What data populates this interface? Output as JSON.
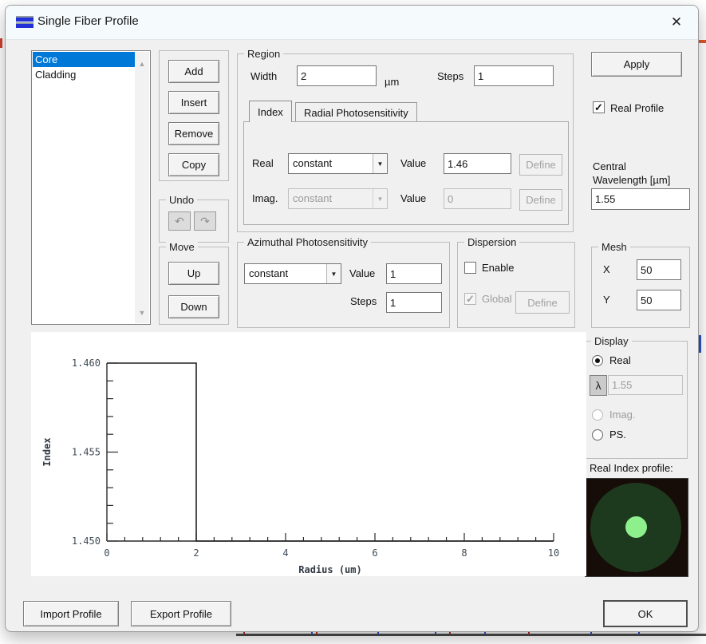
{
  "window": {
    "title": "Single Fiber Profile",
    "close_glyph": "✕"
  },
  "icons": {
    "up": "▲",
    "down": "▼",
    "undo": "↶",
    "redo": "↷",
    "check": "✓",
    "combo_arrow": "▼"
  },
  "colors": {
    "selection": "#0078d7",
    "title_bar": "#f5fafd",
    "dialog_bg": "#f0f0f0"
  },
  "layers": {
    "items": [
      {
        "label": "Core",
        "selected": true
      },
      {
        "label": "Cladding",
        "selected": false
      }
    ]
  },
  "actions": {
    "add": "Add",
    "insert": "Insert",
    "remove": "Remove",
    "copy": "Copy"
  },
  "undo_group": {
    "label": "Undo"
  },
  "move_group": {
    "label": "Move",
    "up": "Up",
    "down": "Down"
  },
  "region": {
    "label": "Region",
    "width_label": "Width",
    "width_value": "2",
    "width_unit": "µm",
    "steps_label": "Steps",
    "steps_value": "1",
    "tabs": {
      "index": "Index",
      "radial": "Radial Photosensitivity"
    },
    "index_tab": {
      "real_label": "Real",
      "real_mode": "constant",
      "real_value_label": "Value",
      "real_value": "1.46",
      "real_define": "Define",
      "imag_label": "Imag.",
      "imag_mode": "constant",
      "imag_value_label": "Value",
      "imag_value": "0",
      "imag_define": "Define"
    }
  },
  "azimuthal": {
    "label": "Azimuthal Photosensitivity",
    "mode": "constant",
    "value_label": "Value",
    "value": "1",
    "steps_label": "Steps",
    "steps_value": "1"
  },
  "dispersion": {
    "label": "Dispersion",
    "enable_label": "Enable",
    "global_label": "Global",
    "define_label": "Define"
  },
  "right_panel": {
    "apply_label": "Apply",
    "real_profile_label": "Real Profile",
    "central_wavelength_label_1": "Central",
    "central_wavelength_label_2": "Wavelength [µm]",
    "central_wavelength_value": "1.55"
  },
  "mesh": {
    "label": "Mesh",
    "x_label": "X",
    "x_value": "50",
    "y_label": "Y",
    "y_value": "50"
  },
  "display": {
    "label": "Display",
    "real_label": "Real",
    "lambda_glyph": "λ",
    "wavelength_value": "1.55",
    "imag_label": "Imag.",
    "ps_label": "PS."
  },
  "preview": {
    "label": "Real Index profile:",
    "colors": {
      "bg": "#170d08",
      "cladding": "#1e3a1e",
      "core": "#8df08d"
    }
  },
  "chart_data": {
    "type": "line",
    "title": "",
    "xlabel": "Radius (um)",
    "ylabel": "Index",
    "xlim": [
      0,
      10
    ],
    "ylim": [
      1.45,
      1.46
    ],
    "x_tick_labels": [
      {
        "v": 0,
        "t": "0"
      },
      {
        "v": 2,
        "t": "2"
      },
      {
        "v": 4,
        "t": "4"
      },
      {
        "v": 6,
        "t": "6"
      },
      {
        "v": 8,
        "t": "8"
      },
      {
        "v": 10,
        "t": "10"
      }
    ],
    "y_tick_labels": [
      {
        "v": 1.45,
        "t": "1.450"
      },
      {
        "v": 1.455,
        "t": "1.455"
      },
      {
        "v": 1.46,
        "t": "1.460"
      }
    ],
    "x_minor_step": 0.4,
    "y_minor_step": 0.001,
    "grid": false,
    "legend": false,
    "series": [
      {
        "name": "real-index-profile",
        "color": "#222222",
        "points": [
          [
            0,
            1.46
          ],
          [
            2,
            1.46
          ],
          [
            2,
            1.45
          ],
          [
            10,
            1.45
          ]
        ]
      }
    ]
  },
  "footer": {
    "import_label": "Import Profile",
    "export_label": "Export Profile",
    "ok_label": "OK"
  }
}
